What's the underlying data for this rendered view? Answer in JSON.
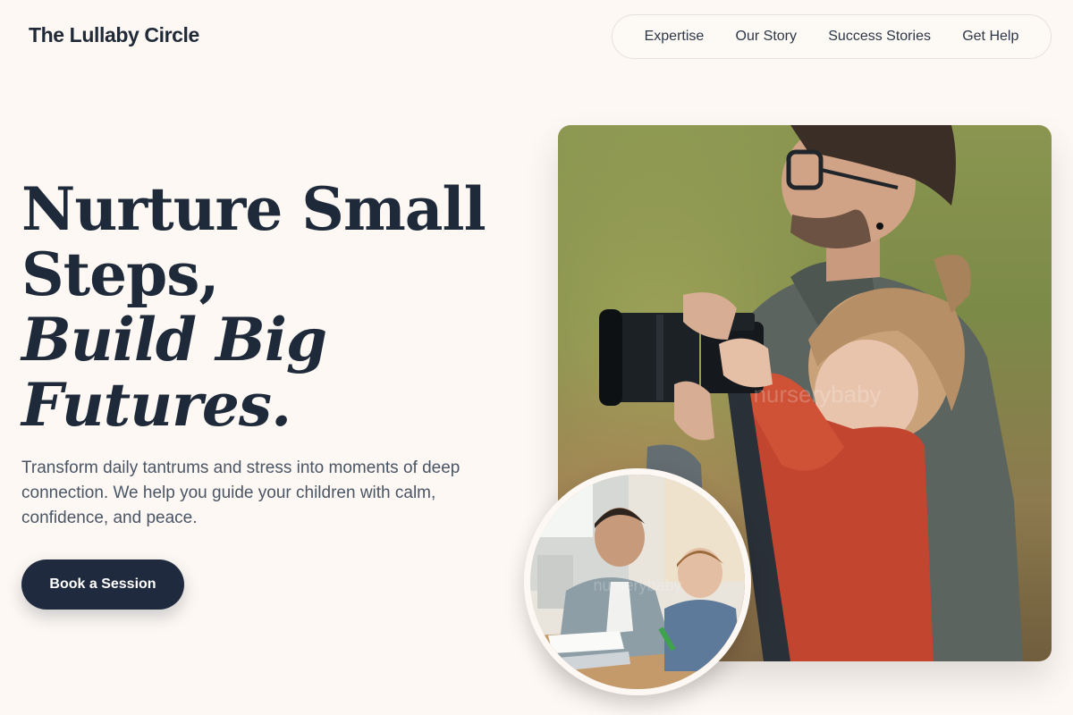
{
  "brand": {
    "name": "The Lullaby Circle"
  },
  "nav": {
    "items": [
      {
        "label": "Expertise"
      },
      {
        "label": "Our Story"
      },
      {
        "label": "Success Stories"
      },
      {
        "label": "Get Help"
      }
    ]
  },
  "hero": {
    "headline_line1": "Nurture Small",
    "headline_line2": "Steps,",
    "headline_line3": "Build Big",
    "headline_line4": "Futures.",
    "description": "Transform daily tantrums and stress into moments of deep connection. We help you guide your children with calm, confidence, and peace.",
    "cta_label": "Book a Session"
  },
  "images": {
    "main_photo": "father-and-daughter-with-camera-photo",
    "inset_photo": "father-helping-son-homework-photo",
    "watermark": "nurserybaby"
  },
  "colors": {
    "background": "#fdf8f3",
    "primary_text": "#1e2a3a",
    "button": "#1f2a3e",
    "body_text": "#4a5565"
  }
}
